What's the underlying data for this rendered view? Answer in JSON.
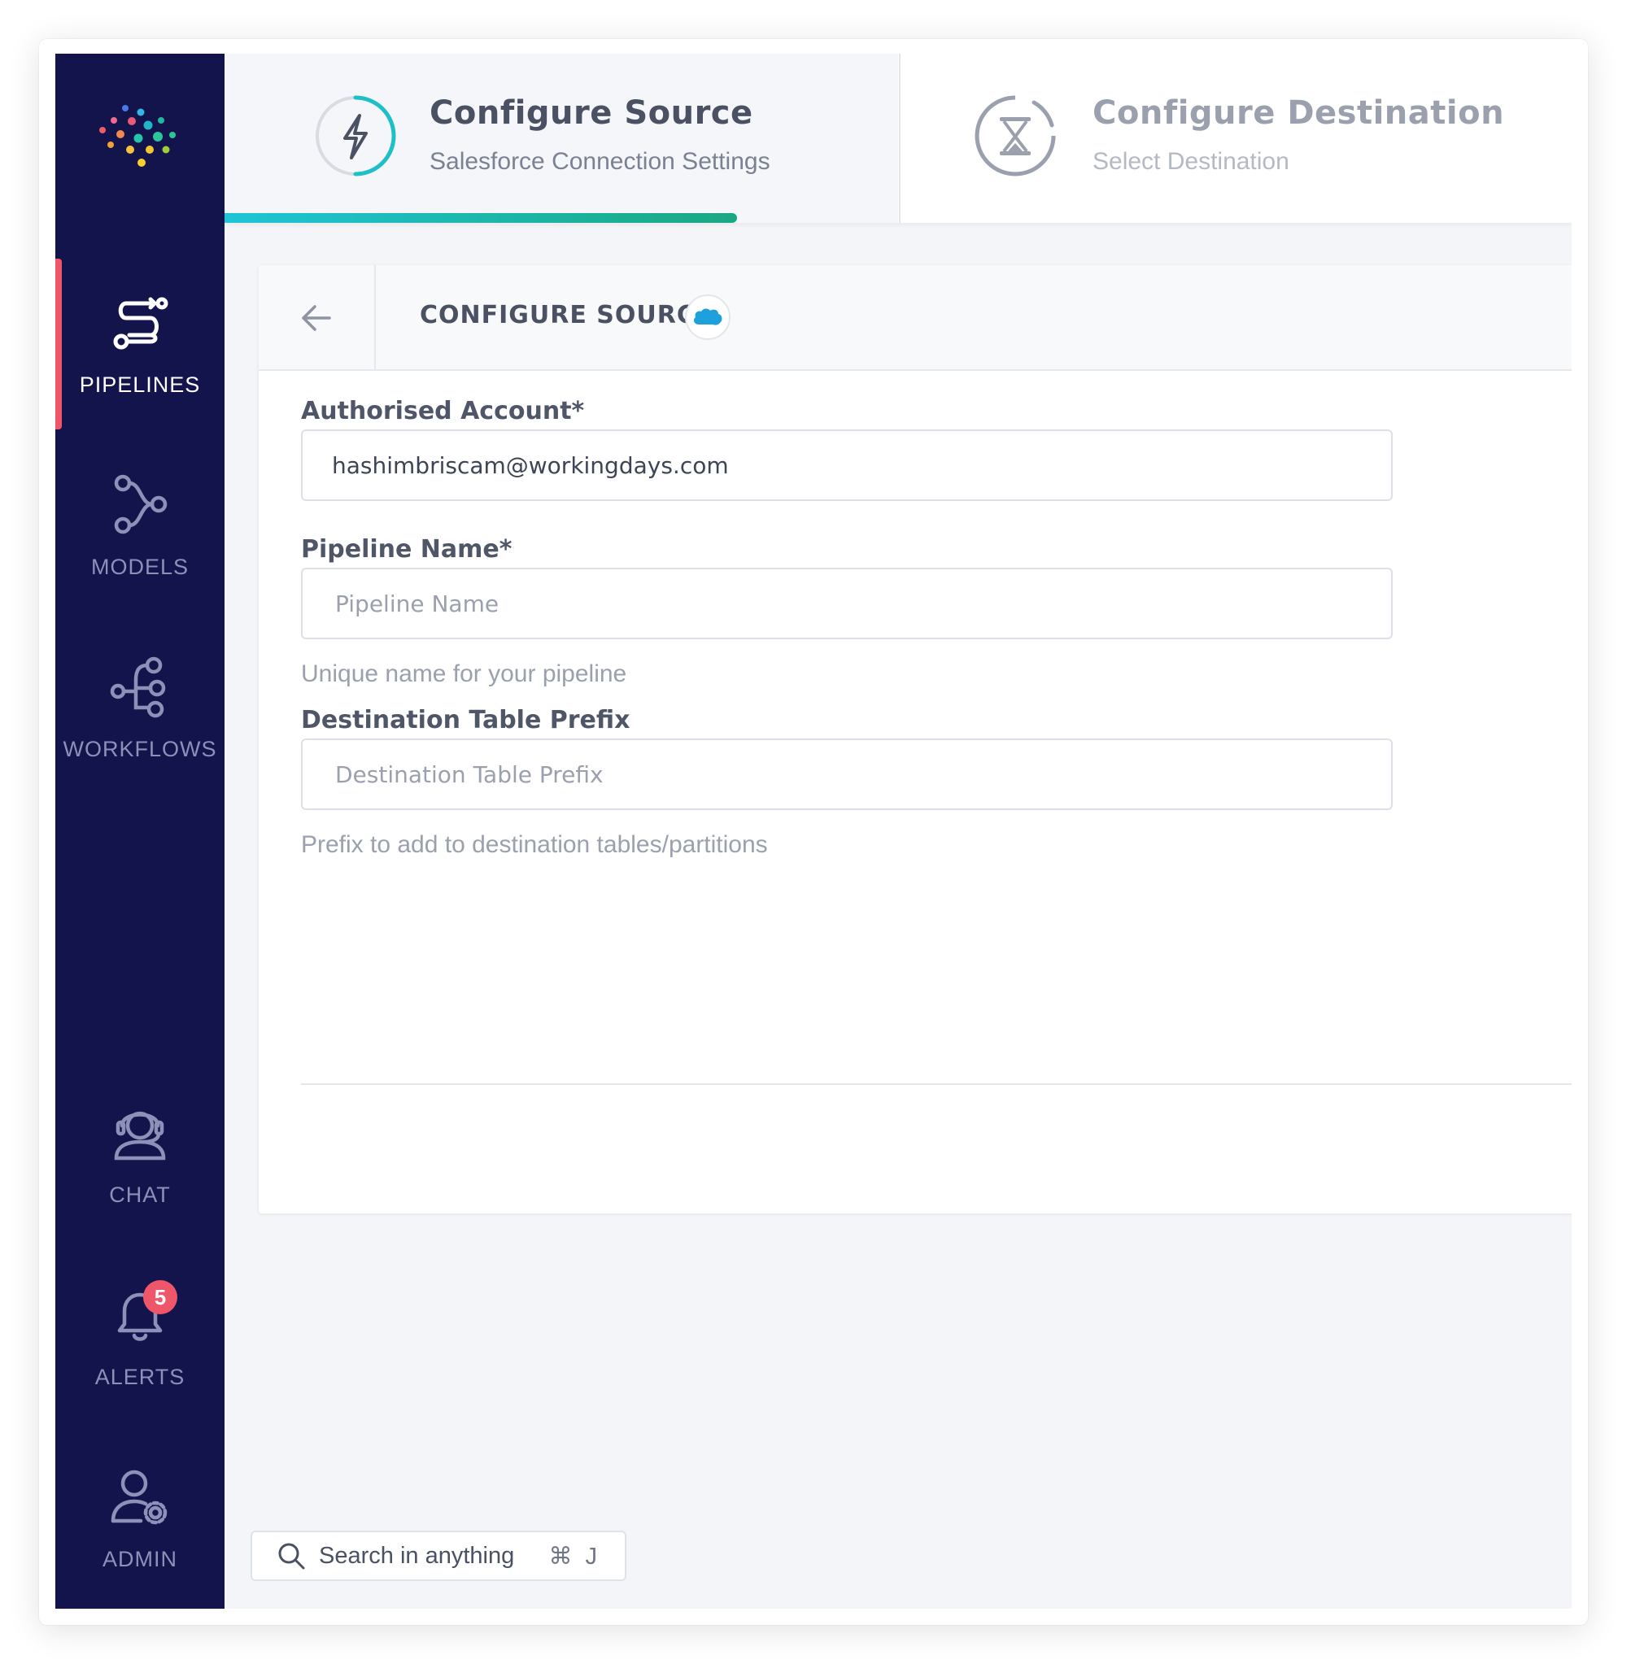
{
  "sidebar": {
    "items": [
      {
        "label": "PIPELINES",
        "icon": "pipelines-icon",
        "active": true
      },
      {
        "label": "MODELS",
        "icon": "models-icon"
      },
      {
        "label": "WORKFLOWS",
        "icon": "workflows-icon"
      },
      {
        "label": "CHAT",
        "icon": "chat-icon"
      },
      {
        "label": "ALERTS",
        "icon": "alerts-icon",
        "badge": "5"
      },
      {
        "label": "ADMIN",
        "icon": "admin-icon"
      }
    ]
  },
  "stepper": {
    "steps": [
      {
        "title": "Configure Source",
        "subtitle": "Salesforce Connection Settings",
        "icon": "lightning-icon",
        "active": true
      },
      {
        "title": "Configure Destination",
        "subtitle": "Select Destination",
        "icon": "hourglass-icon",
        "active": false
      }
    ]
  },
  "card": {
    "title": "CONFIGURE SOURCE",
    "source_logo": "salesforce"
  },
  "form": {
    "account": {
      "label": "Authorised Account*",
      "value": "hashimbriscam@workingdays.com"
    },
    "pipeline_name": {
      "label": "Pipeline Name*",
      "placeholder": "Pipeline Name",
      "help": "Unique name for your pipeline"
    },
    "table_prefix": {
      "label": "Destination Table Prefix",
      "placeholder": "Destination Table Prefix",
      "help": "Prefix to add to destination tables/partitions"
    }
  },
  "search": {
    "placeholder": "Search in anything",
    "shortcut": "⌘ J"
  },
  "colors": {
    "sidebar_bg": "#13144c",
    "active_indicator": "#f0566a",
    "progress_start": "#1fc5d6",
    "progress_end": "#1aa882",
    "badge": "#f0566a"
  }
}
